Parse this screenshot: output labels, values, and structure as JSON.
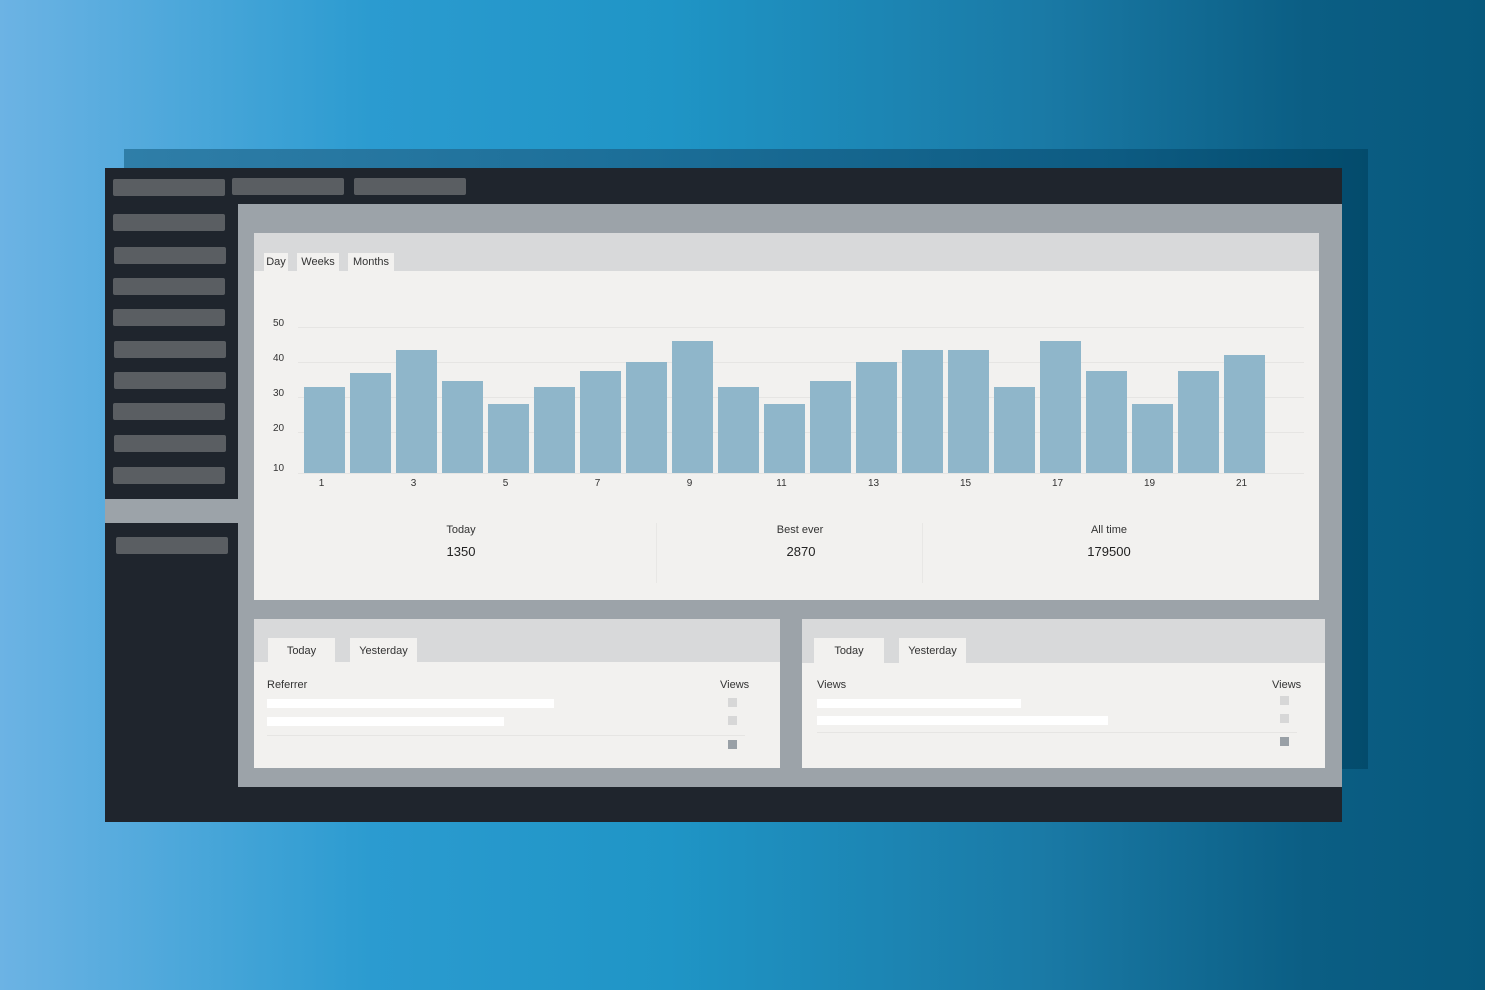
{
  "chart_tabs": [
    "Day",
    "Weeks",
    "Months"
  ],
  "chart_data": {
    "type": "bar",
    "title": "",
    "xlabel": "",
    "ylabel": "",
    "categories": [
      1,
      2,
      3,
      4,
      5,
      6,
      7,
      8,
      9,
      10,
      11,
      12,
      13,
      14,
      15,
      16,
      17,
      18,
      19,
      20,
      21
    ],
    "x_tick_labels": [
      "1",
      "3",
      "5",
      "7",
      "9",
      "11",
      "13",
      "15",
      "17",
      "19",
      "21"
    ],
    "y_tick_labels": [
      "50",
      "40",
      "30",
      "20",
      "10"
    ],
    "values": [
      33,
      37,
      43.5,
      34.5,
      28,
      33,
      37.5,
      40,
      46,
      33,
      28,
      34.5,
      40,
      43.5,
      43.5,
      33,
      46,
      37.5,
      28,
      37.5,
      42
    ],
    "ylim": [
      10,
      50
    ],
    "grid": true,
    "bar_color": "#8fb6ca"
  },
  "stats": [
    {
      "label": "Today",
      "value": "1350"
    },
    {
      "label": "Best ever",
      "value": "2870"
    },
    {
      "label": "All time",
      "value": "179500"
    }
  ],
  "referrer_panel": {
    "tabs": [
      "Today",
      "Yesterday"
    ],
    "col_left": "Referrer",
    "col_right": "Views"
  },
  "views_panel": {
    "tabs": [
      "Today",
      "Yesterday"
    ],
    "col_left": "Views",
    "col_right": "Views"
  },
  "colors": {
    "window_dark": "#1f252d",
    "content_gray": "#9ca3a9",
    "card_bg": "#f2f1ef",
    "placeholder_pill": "#5a5e62"
  }
}
